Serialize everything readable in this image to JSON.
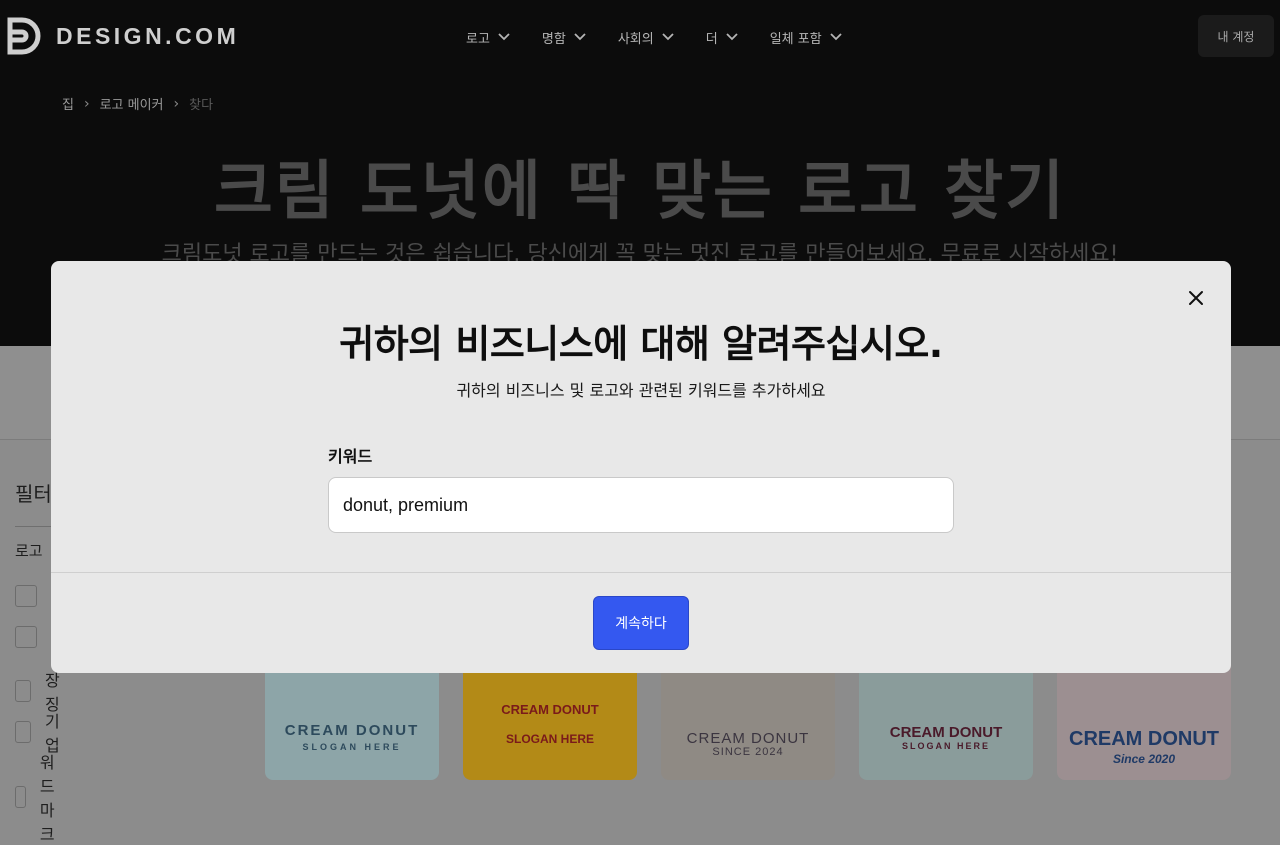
{
  "header": {
    "logo_text": "DESIGN.COM",
    "nav": [
      {
        "label": "로고"
      },
      {
        "label": "명함"
      },
      {
        "label": "사회의"
      },
      {
        "label": "더"
      },
      {
        "label": "일체 포함"
      }
    ],
    "account_label": "내 계정"
  },
  "breadcrumb": [
    "집",
    "로고 메이커",
    "찾다"
  ],
  "hero": {
    "title": "크림 도넛에 딱 맞는 로고 찾기",
    "subtitle": "크림도넛 로고를 만드는 것은 쉽습니다. 당신에게 꼭 맞는 멋진 로고를 만들어보세요. 무료로 시작하세요!"
  },
  "filters": {
    "title": "필터",
    "group_label": "로고",
    "options": [
      "",
      "",
      "장징",
      "기업",
      "워드마크"
    ]
  },
  "cards": [
    {
      "name": "CREAM DONUT",
      "tagline": "SLOGAN HERE",
      "bg": "#8da5a8",
      "fg": "#2d4a5c"
    },
    {
      "name": "CREAM DONUT",
      "tagline": "SLOGAN HERE",
      "bg": "#b38a17",
      "fg": "#7a1a1a"
    },
    {
      "name": "CREAM DONUT",
      "tagline": "SINCE 2024",
      "bg": "#8f8a84",
      "fg": "#3b3540"
    },
    {
      "name": "CREAM DONUT",
      "tagline": "SLOGAN HERE",
      "bg": "#8a9c9b",
      "fg": "#4a1a2a"
    },
    {
      "name": "CREAM DONUT",
      "tagline": "Since 2020",
      "bg": "#9c8f91",
      "fg": "#1f3a66"
    }
  ],
  "modal": {
    "title": "귀하의 비즈니스에 대해 알려주십시오.",
    "subtitle": "귀하의 비즈니스 및 로고와 관련된 키워드를 추가하세요",
    "keyword_label": "키워드",
    "keyword_value": "donut, premium",
    "continue_label": "계속하다"
  },
  "colors": {
    "accent": "#3458f0",
    "modal_bg": "#e8e8e8",
    "hero_bg": "#0c0c0c"
  }
}
